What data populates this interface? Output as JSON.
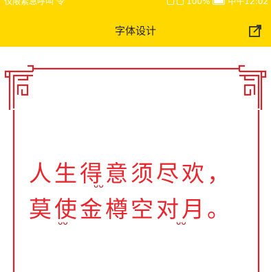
{
  "status_bar": {
    "left_text": "仅限紧急呼叫 令",
    "battery": "100%",
    "time": "中午12:02"
  },
  "navbar": {
    "title": "字体设计",
    "share_icon": "share-icon"
  },
  "poem": {
    "line1": "人生得意须尽欢，",
    "line2": "莫使金樽空对月。"
  },
  "colors": {
    "brand_yellow": "#ffd800",
    "frame_red": "#d9232b",
    "text_red": "#e8262e"
  }
}
